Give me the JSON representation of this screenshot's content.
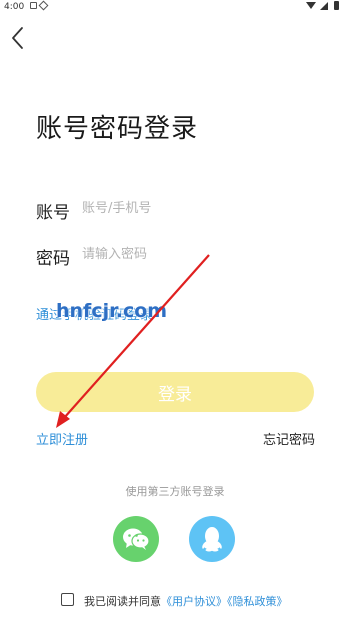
{
  "status_bar": {
    "time": "4:00"
  },
  "page": {
    "title": "账号密码登录"
  },
  "account": {
    "label": "账号",
    "placeholder": "账号/手机号"
  },
  "password": {
    "label": "密码",
    "placeholder": "请输入密码"
  },
  "sms_login_link": "通过手机验证码登录",
  "watermark": "hnfcjr.com",
  "login_button": "登录",
  "register_link": "立即注册",
  "forgot_password_link": "忘记密码",
  "third_party": {
    "label": "使用第三方账号登录",
    "providers": [
      "wechat",
      "qq"
    ]
  },
  "agreement": {
    "prefix": "我已阅读并同意",
    "user_agreement": "《用户协议》",
    "privacy_policy": "《隐私政策》"
  },
  "colors": {
    "accent_yellow": "#f8ec98",
    "link_blue": "#2f8fd8",
    "wechat_green": "#67d26d",
    "qq_blue": "#5ec3f5",
    "arrow_red": "#e02020"
  }
}
